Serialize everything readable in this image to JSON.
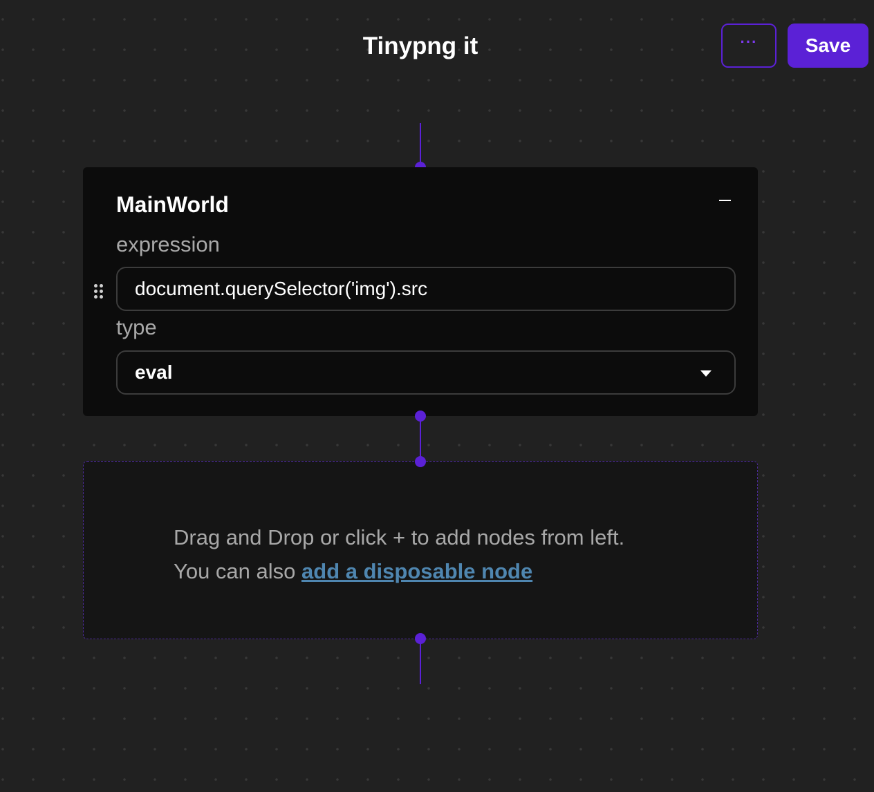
{
  "header": {
    "title": "Tinypng it",
    "more_label": "···",
    "save_label": "Save"
  },
  "node": {
    "title": "MainWorld",
    "collapse_symbol": "−",
    "fields": {
      "expression_label": "expression",
      "expression_value": "document.querySelector('img').src",
      "type_label": "type",
      "type_value": "eval"
    }
  },
  "drop_zone": {
    "line1": "Drag and Drop or click + to add nodes from left.",
    "line2_prefix": "You can also ",
    "link_text": "add a disposable node"
  },
  "icons": {
    "more": "ellipsis-icon",
    "collapse": "minus-icon",
    "drag": "drag-handle-icon",
    "dropdown": "caret-down-icon"
  },
  "colors": {
    "background": "#212121",
    "accent": "#5b21d6",
    "card": "#0c0c0c",
    "drop_zone": "#151515",
    "link": "#4f86b0",
    "muted_text": "#a8a8a8"
  }
}
